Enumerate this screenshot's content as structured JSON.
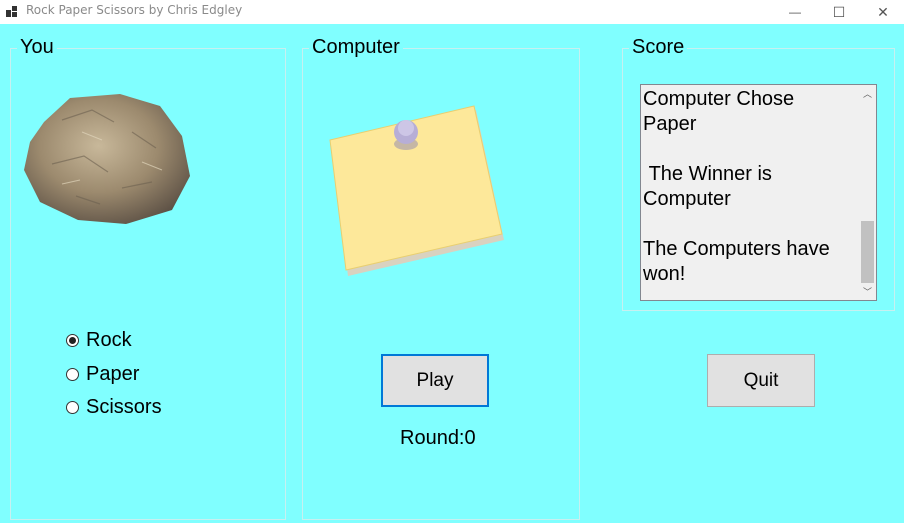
{
  "window": {
    "title": "Rock Paper Scissors by Chris Edgley",
    "minimize_glyph": "—",
    "maximize_glyph": "☐",
    "close_glyph": "✕"
  },
  "you": {
    "group_label": "You",
    "image_icon": "rock-image",
    "options": [
      {
        "label": "Rock",
        "checked": true
      },
      {
        "label": "Paper",
        "checked": false
      },
      {
        "label": "Scissors",
        "checked": false
      }
    ]
  },
  "computer": {
    "group_label": "Computer",
    "image_icon": "sticky-note-paper-image",
    "play_label": "Play",
    "round_text": "Round:0"
  },
  "score": {
    "group_label": "Score",
    "log_text": "Computer Chose\nPaper\n\n The Winner is\nComputer\n\nThe Computers have\nwon!",
    "scroll_up_glyph": "︿",
    "scroll_down_glyph": "﹀",
    "quit_label": "Quit"
  },
  "colors": {
    "background": "#80ffff",
    "button_face": "#e1e1e1",
    "focus_border": "#0078d7"
  }
}
